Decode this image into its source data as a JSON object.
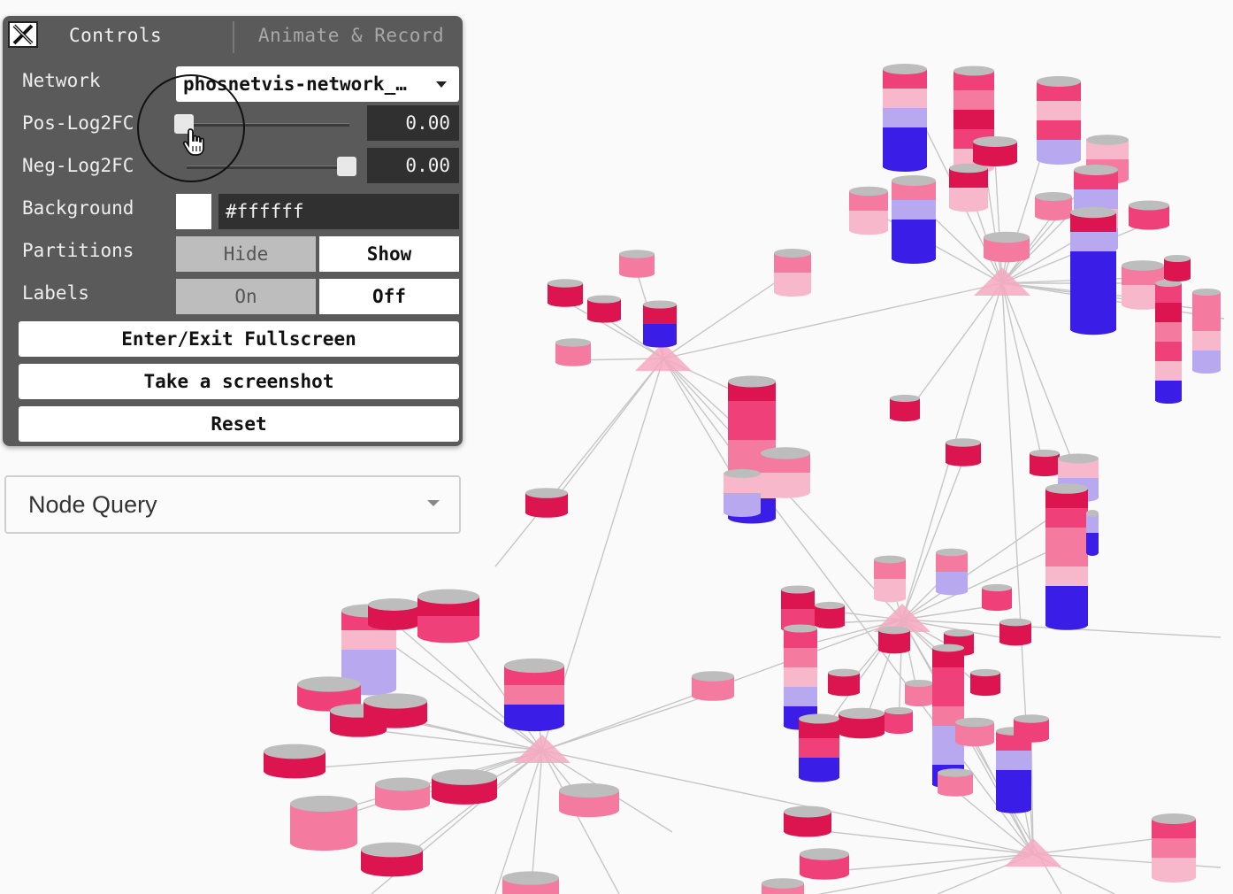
{
  "controls": {
    "tabs": {
      "controls": "Controls",
      "animate": "Animate & Record"
    },
    "close_icon": "close-icon",
    "network": {
      "label": "Network",
      "value": "phosnetvis-network_…"
    },
    "pos_log2fc": {
      "label": "Pos-Log2FC",
      "value": "0.00",
      "level": 0.0
    },
    "neg_log2fc": {
      "label": "Neg-Log2FC",
      "value": "0.00",
      "level": 1.0
    },
    "background": {
      "label": "Background",
      "value": "#ffffff"
    },
    "partitions": {
      "label": "Partitions",
      "options": [
        "Hide",
        "Show"
      ],
      "selected": "Show"
    },
    "labels": {
      "label": "Labels",
      "options": [
        "On",
        "Off"
      ],
      "selected": "Off"
    },
    "buttons": {
      "fullscreen": "Enter/Exit Fullscreen",
      "screenshot": "Take a screenshot",
      "reset": "Reset"
    }
  },
  "node_query": {
    "label": "Node Query"
  },
  "colors": {
    "panel_bg": "#5a5a5a",
    "crimson": "#dc1450",
    "hot_pink": "#f0407a",
    "pink": "#f47aa0",
    "light_pink": "#f8b8cc",
    "lavender": "#b8a8f0",
    "blue": "#3a1ee8",
    "hub_pink": "#f4a8c0",
    "edge_gray": "#c8c8c8"
  }
}
